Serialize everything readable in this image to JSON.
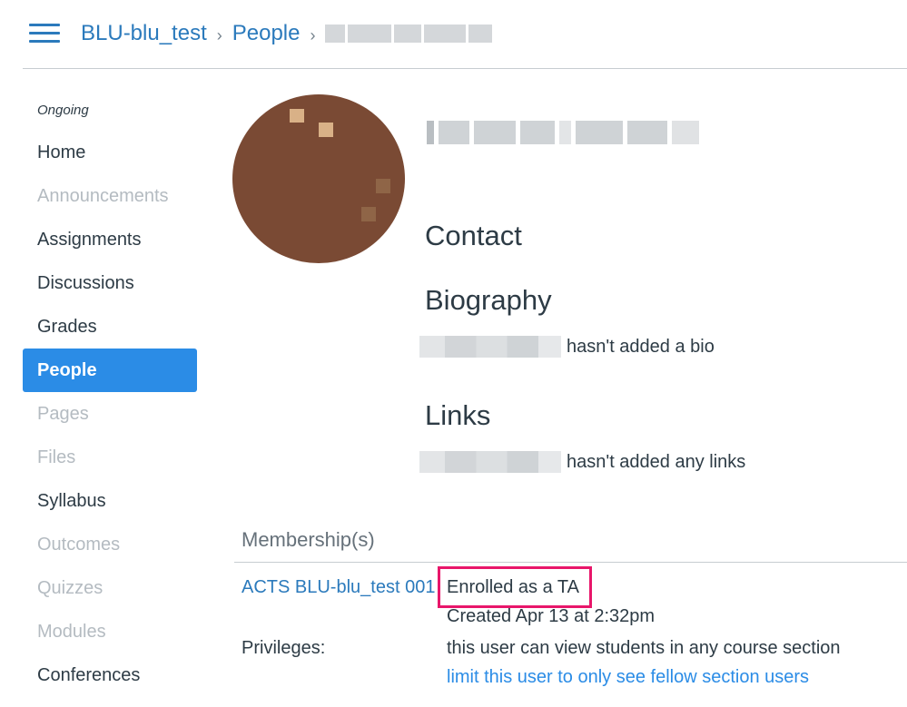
{
  "colors": {
    "accent": "#2b8ce6",
    "link": "#2b7abc",
    "text": "#2d3b45",
    "muted": "#b4bbc1",
    "highlight": "#e8166a"
  },
  "header": {
    "menu_icon": "hamburger-icon",
    "breadcrumbs": [
      {
        "label": "BLU-blu_test"
      },
      {
        "label": "People"
      }
    ],
    "separator": "›"
  },
  "sidebar": {
    "term": "Ongoing",
    "items": [
      {
        "label": "Home",
        "state": "enabled"
      },
      {
        "label": "Announcements",
        "state": "disabled"
      },
      {
        "label": "Assignments",
        "state": "enabled"
      },
      {
        "label": "Discussions",
        "state": "enabled"
      },
      {
        "label": "Grades",
        "state": "enabled"
      },
      {
        "label": "People",
        "state": "active"
      },
      {
        "label": "Pages",
        "state": "disabled"
      },
      {
        "label": "Files",
        "state": "disabled"
      },
      {
        "label": "Syllabus",
        "state": "enabled"
      },
      {
        "label": "Outcomes",
        "state": "disabled"
      },
      {
        "label": "Quizzes",
        "state": "disabled"
      },
      {
        "label": "Modules",
        "state": "disabled"
      },
      {
        "label": "Conferences",
        "state": "enabled"
      }
    ]
  },
  "profile": {
    "contact_heading": "Contact",
    "bio_heading": "Biography",
    "bio_text": "hasn't added a bio",
    "links_heading": "Links",
    "links_text": "hasn't added any links"
  },
  "memberships": {
    "heading": "Membership(s)",
    "course": "ACTS BLU-blu_test 001",
    "enrollment": "Enrolled as a TA",
    "created": "Created Apr 13 at 2:32pm",
    "privileges_label": "Privileges:",
    "privileges_text": "this user can view students in any course section",
    "limit_link": "limit this user to only see fellow section users"
  }
}
